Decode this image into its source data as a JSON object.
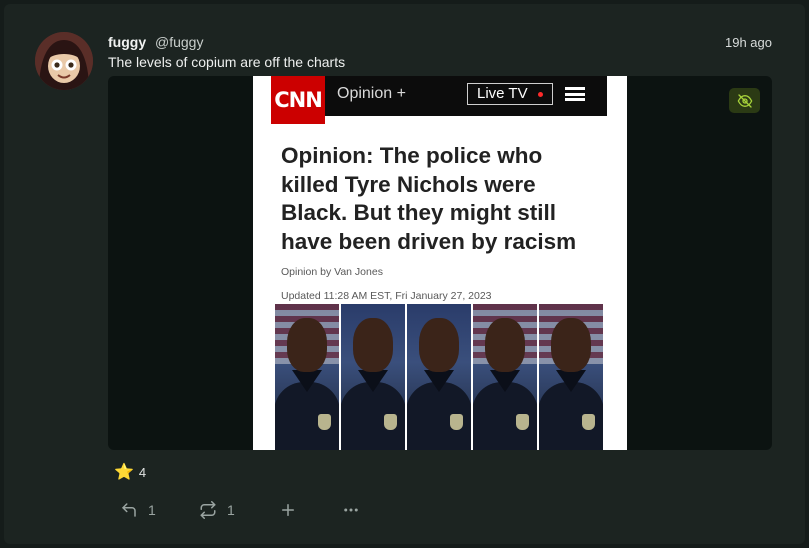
{
  "post": {
    "display_name": "fuggy",
    "handle": "@fuggy",
    "timestamp": "19h ago",
    "text": "The levels of copium are off the charts"
  },
  "media": {
    "sensitive_toggle_icon": "eye-off-icon",
    "article": {
      "logo": "CNN",
      "section": "Opinion +",
      "live_tv": "Live TV",
      "headline": "Opinion: The police who killed Tyre Nichols were Black. But they might still have been driven by racism",
      "byline": "Opinion by Van Jones",
      "updated": "Updated 11:28 AM EST, Fri January 27, 2023"
    }
  },
  "reactions": {
    "emoji": "⭐",
    "count": "4"
  },
  "actions": {
    "reply_count": "1",
    "boost_count": "1",
    "reply_icon": "reply-icon",
    "boost_icon": "repeat-icon",
    "add_icon": "plus-icon",
    "more_icon": "more-icon"
  },
  "colors": {
    "page_bg": "#151c1a",
    "card_bg": "#1c2421",
    "accent_green": "#a6d13a",
    "muted": "#9aa4a1"
  }
}
